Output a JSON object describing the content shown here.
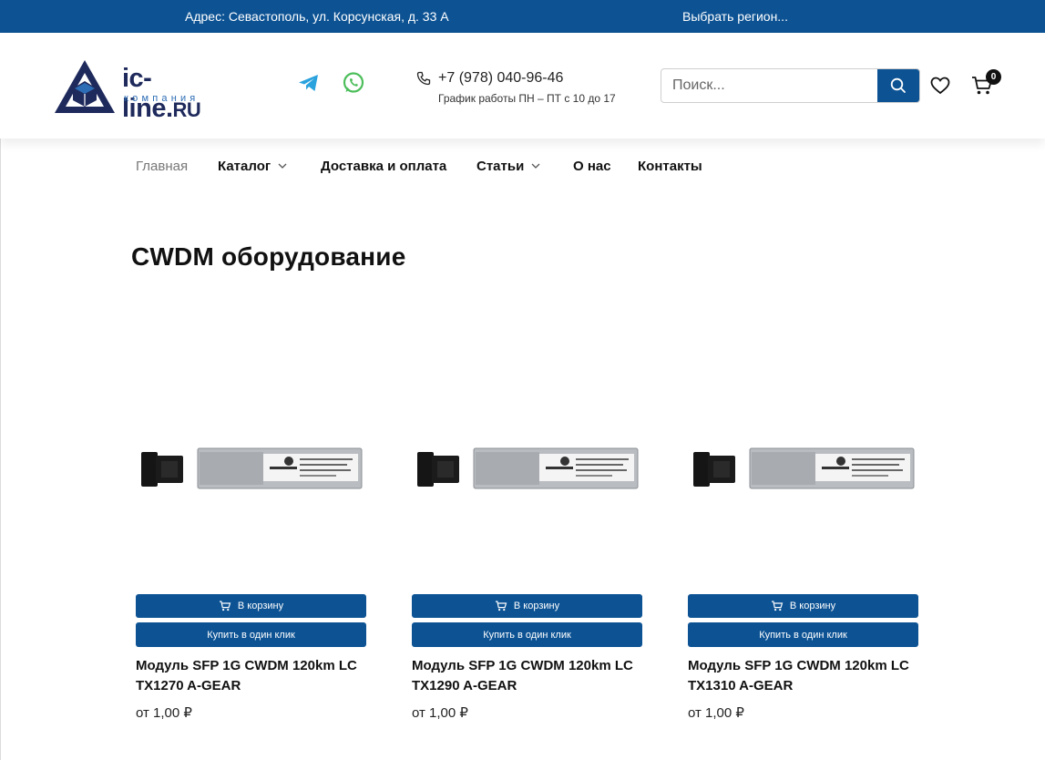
{
  "topbar": {
    "address": "Адрес: Севастополь, ул. Корсунская, д. 33 А",
    "region": "Выбрать регион..."
  },
  "header": {
    "logo_brand": "ic-line.",
    "logo_tld": "RU",
    "logo_sub": "компания",
    "phone": "+7 (978) 040-96-46",
    "schedule": "График работы ПН – ПТ с 10 до 17",
    "search_placeholder": "Поиск...",
    "cart_count": "0"
  },
  "colors": {
    "brand_blue": "#0d5394",
    "logo_navy": "#1f2a5c",
    "telegram": "#2aa2dd",
    "whatsapp": "#4cbe5a"
  },
  "nav": {
    "items": [
      {
        "label": "Главная"
      },
      {
        "label": "Каталог"
      },
      {
        "label": "Доставка и оплата"
      },
      {
        "label": "Статьи"
      },
      {
        "label": "О нас"
      },
      {
        "label": "Контакты"
      }
    ]
  },
  "page": {
    "title": "CWDM оборудование"
  },
  "products": [
    {
      "name": "Модуль SFP 1G CWDM 120km LC TX1270 A-GEAR",
      "price": "от 1,00 ₽",
      "add_to_cart": "В корзину",
      "one_click": "Купить в один клик"
    },
    {
      "name": "Модуль SFP 1G CWDM 120km LC TX1290 A-GEAR",
      "price": "от 1,00 ₽",
      "add_to_cart": "В корзину",
      "one_click": "Купить в один клик"
    },
    {
      "name": "Модуль SFP 1G CWDM 120km LC TX1310 A-GEAR",
      "price": "от 1,00 ₽",
      "add_to_cart": "В корзину",
      "one_click": "Купить в один клик"
    }
  ]
}
